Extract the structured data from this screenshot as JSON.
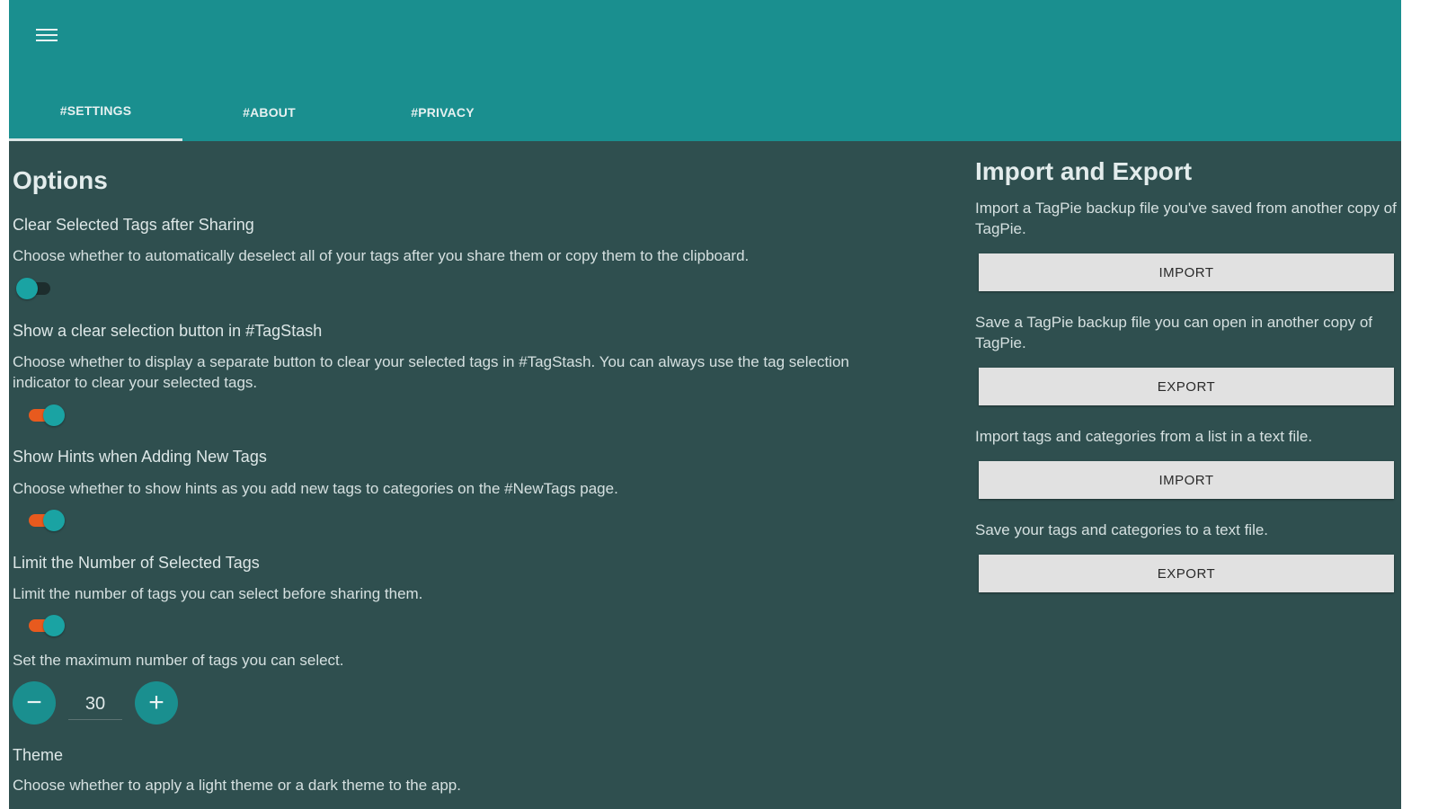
{
  "tabs": [
    {
      "label": "#SETTINGS",
      "active": true
    },
    {
      "label": "#ABOUT",
      "active": false
    },
    {
      "label": "#PRIVACY",
      "active": false
    }
  ],
  "options": {
    "heading": "Options",
    "clear_selected": {
      "title": "Clear Selected Tags after Sharing",
      "description": "Choose whether to automatically deselect all of your tags after you share them or copy them to the clipboard.",
      "enabled": false
    },
    "clear_button": {
      "title": "Show a clear selection button in #TagStash",
      "description": "Choose whether to display a separate button to clear your selected tags in #TagStash. You can always use the tag selection indicator to clear your selected tags.",
      "enabled": true
    },
    "hints": {
      "title": "Show Hints when Adding New Tags",
      "description": "Choose whether to show hints as you add new tags to categories on the #NewTags page.",
      "enabled": true
    },
    "limit": {
      "title": "Limit the Number of Selected Tags",
      "description": "Limit the number of tags you can select before sharing them.",
      "enabled": true
    },
    "max_tags": {
      "label": "Set the maximum number of tags you can select.",
      "value": "30",
      "minus": "−",
      "plus": "+"
    },
    "theme": {
      "title": "Theme",
      "description": "Choose whether to apply a light theme or a dark theme to the app."
    }
  },
  "import_export": {
    "heading": "Import and Export",
    "items": [
      {
        "description": "Import a TagPie backup file you've saved from another copy of TagPie.",
        "button": "IMPORT"
      },
      {
        "description": "Save a TagPie backup file you can open in another copy of TagPie.",
        "button": "EXPORT"
      },
      {
        "description": "Import tags and categories from a list in a text file.",
        "button": "IMPORT"
      },
      {
        "description": "Save your tags and categories to a text file.",
        "button": "EXPORT"
      }
    ]
  },
  "colors": {
    "app_bar": "#1a8f8f",
    "background": "#2f4f4f",
    "accent": "#1aa3a3",
    "toggle_on_track": "#e85a1e"
  }
}
